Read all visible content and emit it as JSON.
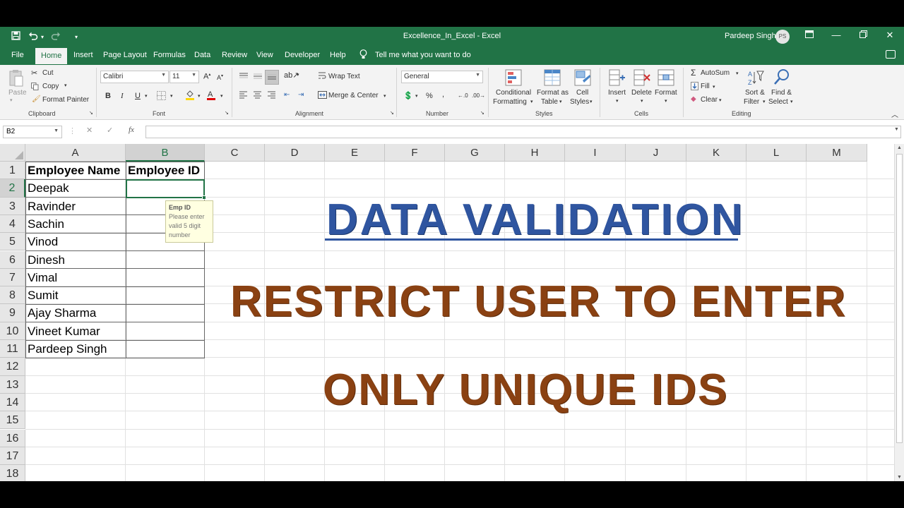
{
  "window": {
    "title": "Excellence_In_Excel  -  Excel",
    "user_name": "Pardeep Singh",
    "user_initials": "PS"
  },
  "quick_access": {
    "save_icon": "save-icon",
    "undo_icon": "undo-icon",
    "redo_icon": "redo-icon"
  },
  "menu": {
    "items": [
      "File",
      "Home",
      "Insert",
      "Page Layout",
      "Formulas",
      "Data",
      "Review",
      "View",
      "Developer",
      "Help"
    ],
    "active": "Home",
    "tell_me": "Tell me what you want to do"
  },
  "ribbon": {
    "clipboard": {
      "paste": "Paste",
      "cut": "Cut",
      "copy": "Copy",
      "format_painter": "Format Painter",
      "label": "Clipboard"
    },
    "font": {
      "name": "Calibri",
      "size": "11",
      "bold": "B",
      "italic": "I",
      "underline": "U",
      "label": "Font"
    },
    "alignment": {
      "wrap_text": "Wrap Text",
      "merge_center": "Merge & Center",
      "label": "Alignment"
    },
    "number": {
      "format": "General",
      "label": "Number"
    },
    "styles": {
      "conditional_1": "Conditional",
      "conditional_2": "Formatting",
      "format_as_1": "Format as",
      "format_as_2": "Table",
      "cell_styles_1": "Cell",
      "cell_styles_2": "Styles",
      "label": "Styles"
    },
    "cells": {
      "insert": "Insert",
      "delete": "Delete",
      "format": "Format",
      "label": "Cells"
    },
    "editing": {
      "autosum": "AutoSum",
      "fill": "Fill",
      "clear": "Clear",
      "sort_1": "Sort &",
      "sort_2": "Filter",
      "find_1": "Find &",
      "find_2": "Select",
      "label": "Editing"
    }
  },
  "formula_bar": {
    "name_box": "B2",
    "fx": "fx",
    "content": ""
  },
  "sheet": {
    "columns": [
      "A",
      "B",
      "C",
      "D",
      "E",
      "F",
      "G",
      "H",
      "I",
      "J",
      "K",
      "L",
      "M"
    ],
    "rows": [
      "1",
      "2",
      "3",
      "4",
      "5",
      "6",
      "7",
      "8",
      "9",
      "10",
      "11",
      "12",
      "13",
      "14",
      "15",
      "16",
      "17",
      "18"
    ],
    "selected_column": "B",
    "selected_row": "2",
    "header_a": "Employee Name",
    "header_b": "Employee ID",
    "names": [
      "Deepak",
      "Ravinder",
      "Sachin",
      "Vinod",
      "Dinesh",
      "Vimal",
      "Sumit",
      "Ajay Sharma",
      "Vineet Kumar",
      "Pardeep Singh"
    ]
  },
  "input_message": {
    "title": "Emp ID",
    "body": "Please enter valid 5 digit number"
  },
  "overlay": {
    "line1": "DATA VALIDATION",
    "line2": "RESTRICT USER TO ENTER",
    "line3": "ONLY UNIQUE IDS"
  },
  "colors": {
    "excel_green": "#217346",
    "title_blue": "#2f55a0",
    "text_brown": "#8a4112"
  }
}
